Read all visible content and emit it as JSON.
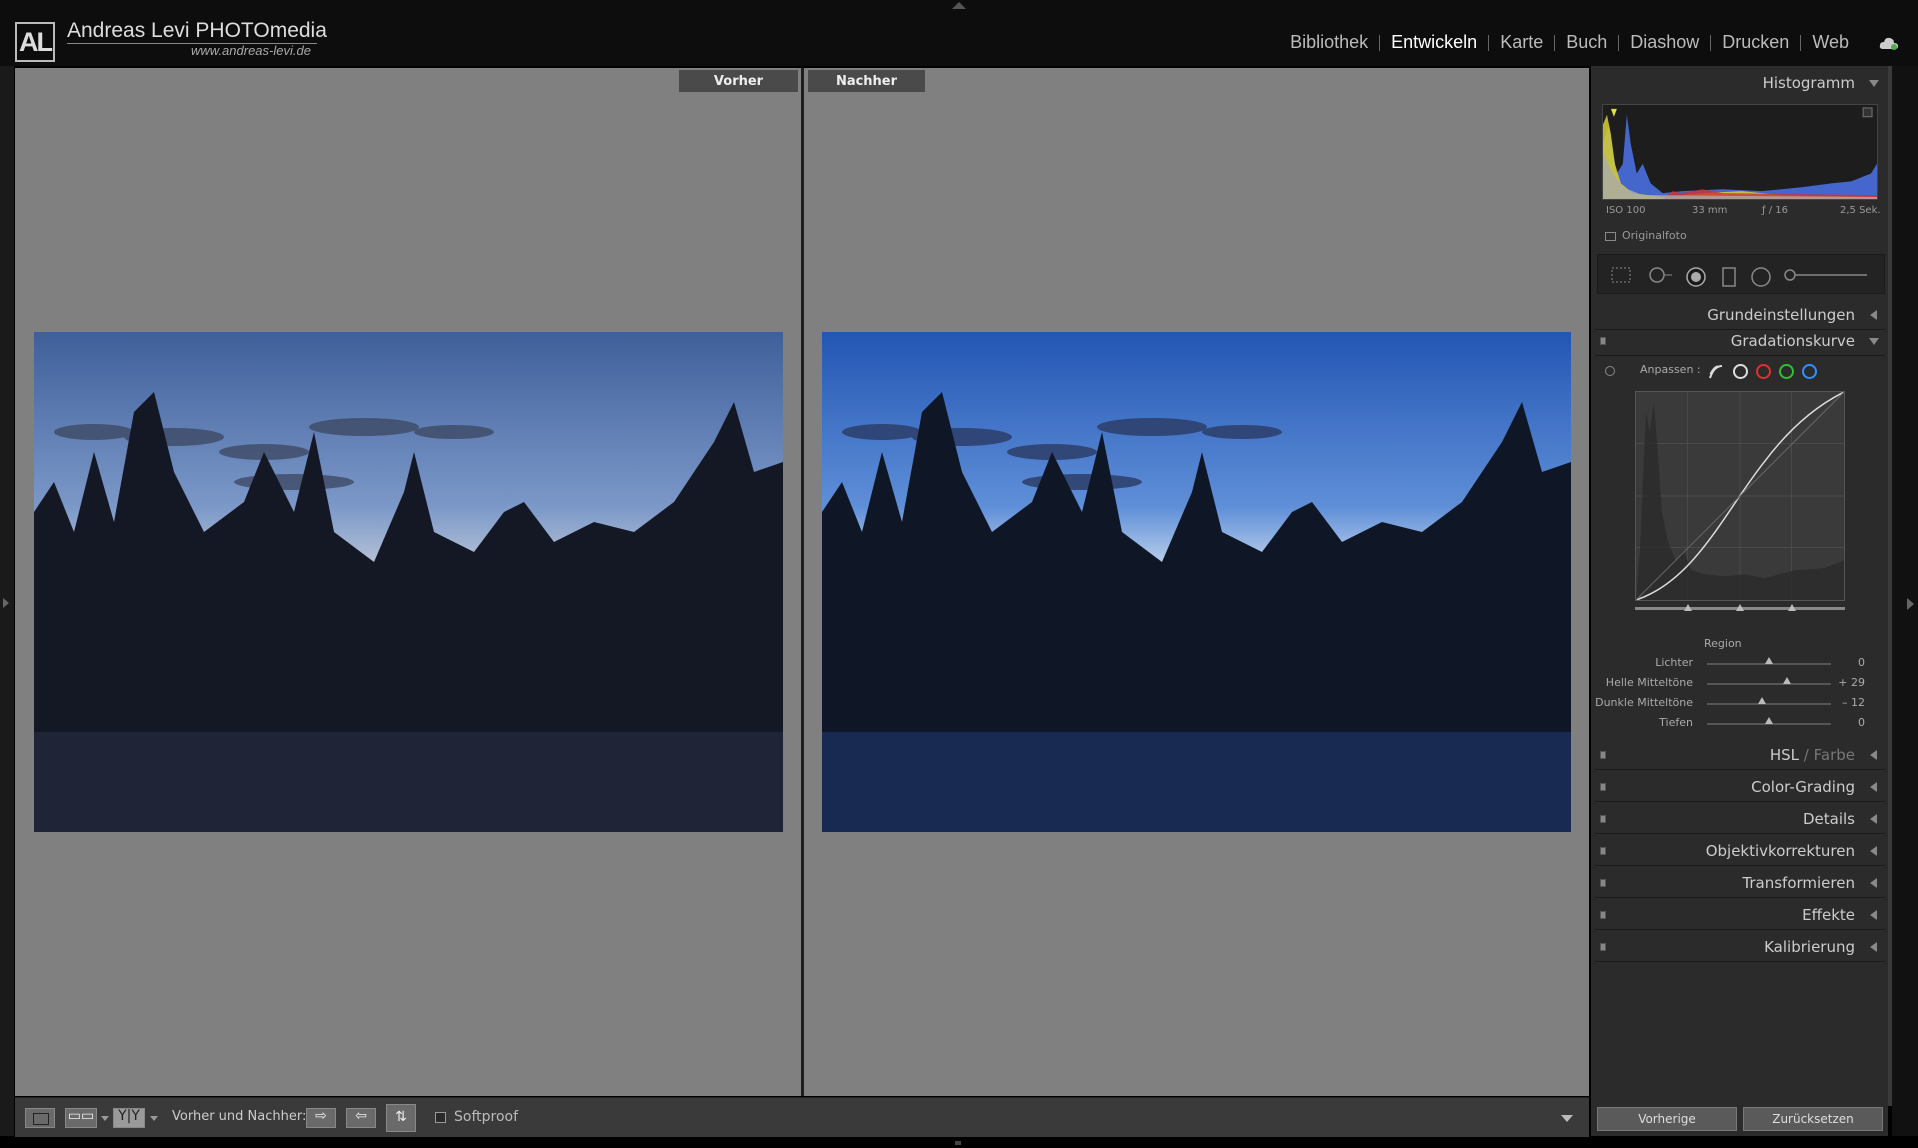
{
  "brand": {
    "logo": "AL",
    "name": "Andreas Levi PHOTOmedia",
    "url": "www.andreas-levi.de"
  },
  "modules": [
    "Bibliothek",
    "Entwickeln",
    "Karte",
    "Buch",
    "Diashow",
    "Drucken",
    "Web"
  ],
  "active_module": "Entwickeln",
  "views": {
    "before_label": "Vorher",
    "after_label": "Nachher"
  },
  "toolbar": {
    "compare_label": "Vorher und Nachher:",
    "softproof_label": "Softproof",
    "softproof_checked": false
  },
  "panel": {
    "histogram_title": "Histogramm",
    "exif": {
      "iso": "ISO 100",
      "focal": "33 mm",
      "aperture": "ƒ / 16",
      "shutter": "2,5 Sek."
    },
    "original_label": "Originalfoto",
    "sections": {
      "basic": "Grundeinstellungen",
      "tone_curve": "Gradationskurve",
      "hsl": "HSL",
      "hsl_sep": " / ",
      "hsl_alt": "Farbe",
      "color_grading": "Color-Grading",
      "details": "Details",
      "lens": "Objektivkorrekturen",
      "transform": "Transformieren",
      "effects": "Effekte",
      "calibration": "Kalibrierung"
    },
    "curve": {
      "adjust_label": "Anpassen :",
      "region_label": "Region",
      "sliders": [
        {
          "label": "Lichter",
          "value": "0",
          "level": 0.5
        },
        {
          "label": "Helle Mitteltöne",
          "value": "+ 29",
          "level": 0.645
        },
        {
          "label": "Dunkle Mitteltöne",
          "value": "– 12",
          "level": 0.44
        },
        {
          "label": "Tiefen",
          "value": "0",
          "level": 0.5
        }
      ]
    },
    "buttons": {
      "previous": "Vorherige",
      "reset": "Zurücksetzen"
    }
  },
  "colors": {
    "accent_red": "#e03030",
    "accent_green": "#30c030",
    "accent_blue": "#3090ff"
  }
}
